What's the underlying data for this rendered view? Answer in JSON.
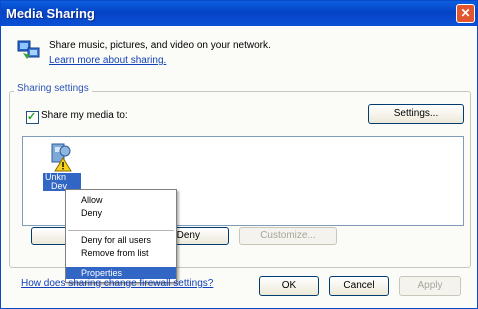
{
  "window": {
    "title": "Media Sharing",
    "close_glyph": "✕"
  },
  "intro": {
    "text": "Share music, pictures, and video on your network.",
    "learn_link": "Learn more about sharing."
  },
  "sharing_settings": {
    "group_label": "Sharing settings",
    "share_checkbox_label": "Share my media to:",
    "share_checked": true,
    "settings_button": "Settings..."
  },
  "device": {
    "label_line1": "Unkn",
    "label_line2": "Dev"
  },
  "context_menu": {
    "items": [
      "Allow",
      "Deny",
      "Deny for all users",
      "Remove from list",
      "Properties"
    ],
    "selected": "Properties"
  },
  "list_buttons": {
    "deny": "Deny",
    "customize": "Customize..."
  },
  "footer": {
    "firewall_link": "How does sharing change firewall settings?",
    "ok": "OK",
    "cancel": "Cancel",
    "apply": "Apply"
  }
}
